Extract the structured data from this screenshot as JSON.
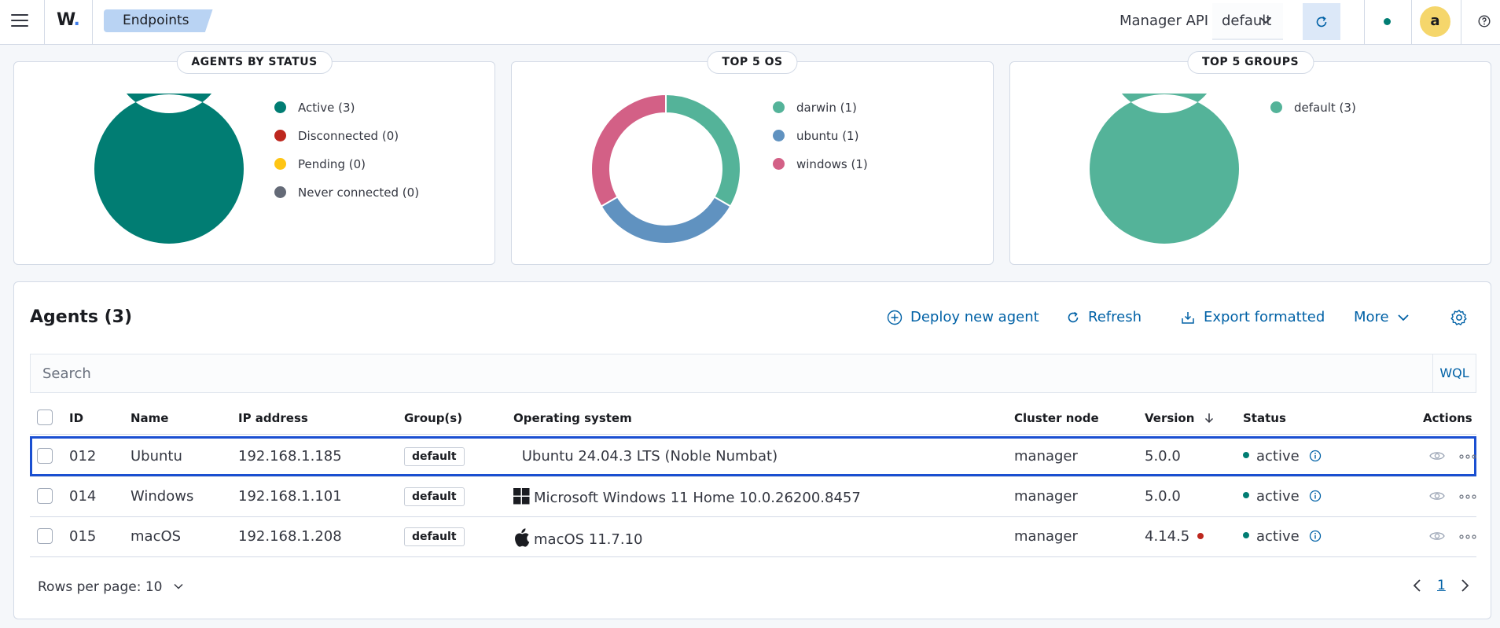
{
  "header": {
    "logo": "W",
    "breadcrumb": "Endpoints",
    "manager_api_label": "Manager API",
    "manager_api_value": "default",
    "avatar_letter": "a"
  },
  "stats": {
    "agents_by_status": {
      "title": "AGENTS BY STATUS",
      "legend": [
        {
          "label": "Active (3)",
          "color": "#017d73"
        },
        {
          "label": "Disconnected (0)",
          "color": "#bd271e"
        },
        {
          "label": "Pending (0)",
          "color": "#fec514"
        },
        {
          "label": "Never connected (0)",
          "color": "#646a77"
        }
      ]
    },
    "top_os": {
      "title": "TOP 5 OS",
      "legend": [
        {
          "label": "darwin (1)",
          "color": "#54b399"
        },
        {
          "label": "ubuntu (1)",
          "color": "#6092c0"
        },
        {
          "label": "windows (1)",
          "color": "#d36086"
        }
      ]
    },
    "top_groups": {
      "title": "TOP 5 GROUPS",
      "legend": [
        {
          "label": "default (3)",
          "color": "#54b399"
        }
      ]
    }
  },
  "chart_data": [
    {
      "type": "pie",
      "categories": [
        "Active",
        "Disconnected",
        "Pending",
        "Never connected"
      ],
      "values": [
        3,
        0,
        0,
        0
      ],
      "title": "AGENTS BY STATUS"
    },
    {
      "type": "pie",
      "categories": [
        "darwin",
        "ubuntu",
        "windows"
      ],
      "values": [
        1,
        1,
        1
      ],
      "title": "TOP 5 OS"
    },
    {
      "type": "pie",
      "categories": [
        "default"
      ],
      "values": [
        3
      ],
      "title": "TOP 5 GROUPS"
    }
  ],
  "agents": {
    "title": "Agents (3)",
    "actions": {
      "deploy": "Deploy new agent",
      "refresh": "Refresh",
      "export": "Export formatted",
      "more": "More"
    },
    "search_placeholder": "Search",
    "wql": "WQL",
    "columns": [
      "ID",
      "Name",
      "IP address",
      "Group(s)",
      "Operating system",
      "Cluster node",
      "Version",
      "Status",
      "Actions"
    ],
    "rows": [
      {
        "id": "012",
        "name": "Ubuntu",
        "ip": "192.168.1.185",
        "group": "default",
        "os": "Ubuntu 24.04.3 LTS (Noble Numbat)",
        "os_icon": "ubuntu-icon",
        "node": "manager",
        "version": "5.0.0",
        "version_outdated": false,
        "status": "active"
      },
      {
        "id": "014",
        "name": "Windows",
        "ip": "192.168.1.101",
        "group": "default",
        "os": "Microsoft Windows 11 Home 10.0.26200.8457",
        "os_icon": "windows-icon",
        "node": "manager",
        "version": "5.0.0",
        "version_outdated": false,
        "status": "active"
      },
      {
        "id": "015",
        "name": "macOS",
        "ip": "192.168.1.208",
        "group": "default",
        "os": "macOS 11.7.10",
        "os_icon": "apple-icon",
        "node": "manager",
        "version": "4.14.5",
        "version_outdated": true,
        "status": "active"
      }
    ],
    "rows_per_page": "Rows per page: 10",
    "current_page": "1"
  },
  "colors": {
    "accent": "#0061a6",
    "active": "#017d73",
    "outdated": "#bd271e",
    "selected_outline": "#1a4fd1"
  }
}
